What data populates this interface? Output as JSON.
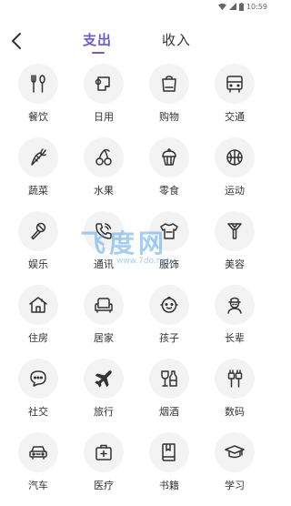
{
  "status": {
    "time": "10:59"
  },
  "header": {
    "tabs": [
      {
        "label": "支出",
        "active": true
      },
      {
        "label": "收入",
        "active": false
      }
    ]
  },
  "categories": [
    {
      "label": "餐饮",
      "icon": "fork-spoon-icon"
    },
    {
      "label": "日用",
      "icon": "tissue-roll-icon"
    },
    {
      "label": "购物",
      "icon": "shopping-bag-icon"
    },
    {
      "label": "交通",
      "icon": "bus-icon"
    },
    {
      "label": "蔬菜",
      "icon": "carrot-icon"
    },
    {
      "label": "水果",
      "icon": "cherry-icon"
    },
    {
      "label": "零食",
      "icon": "cupcake-icon"
    },
    {
      "label": "运动",
      "icon": "basketball-icon"
    },
    {
      "label": "娱乐",
      "icon": "microphone-icon"
    },
    {
      "label": "通讯",
      "icon": "phone-icon"
    },
    {
      "label": "服饰",
      "icon": "shirt-icon"
    },
    {
      "label": "美容",
      "icon": "makeup-icon"
    },
    {
      "label": "住房",
      "icon": "house-icon"
    },
    {
      "label": "居家",
      "icon": "sofa-icon"
    },
    {
      "label": "孩子",
      "icon": "baby-icon"
    },
    {
      "label": "长辈",
      "icon": "elder-icon"
    },
    {
      "label": "社交",
      "icon": "chat-bubble-icon"
    },
    {
      "label": "旅行",
      "icon": "airplane-icon"
    },
    {
      "label": "烟酒",
      "icon": "wine-icon"
    },
    {
      "label": "数码",
      "icon": "cable-icon"
    },
    {
      "label": "汽车",
      "icon": "car-icon"
    },
    {
      "label": "医疗",
      "icon": "medical-kit-icon"
    },
    {
      "label": "书籍",
      "icon": "book-icon"
    },
    {
      "label": "学习",
      "icon": "graduation-cap-icon"
    }
  ],
  "watermark": {
    "title": "飞度网",
    "url": "www.7do.net"
  },
  "colors": {
    "accent": "#6b5bd2",
    "icon_stroke": "#333333",
    "circle_bg": "#f3f3f3",
    "watermark": "#5aa7ea"
  }
}
